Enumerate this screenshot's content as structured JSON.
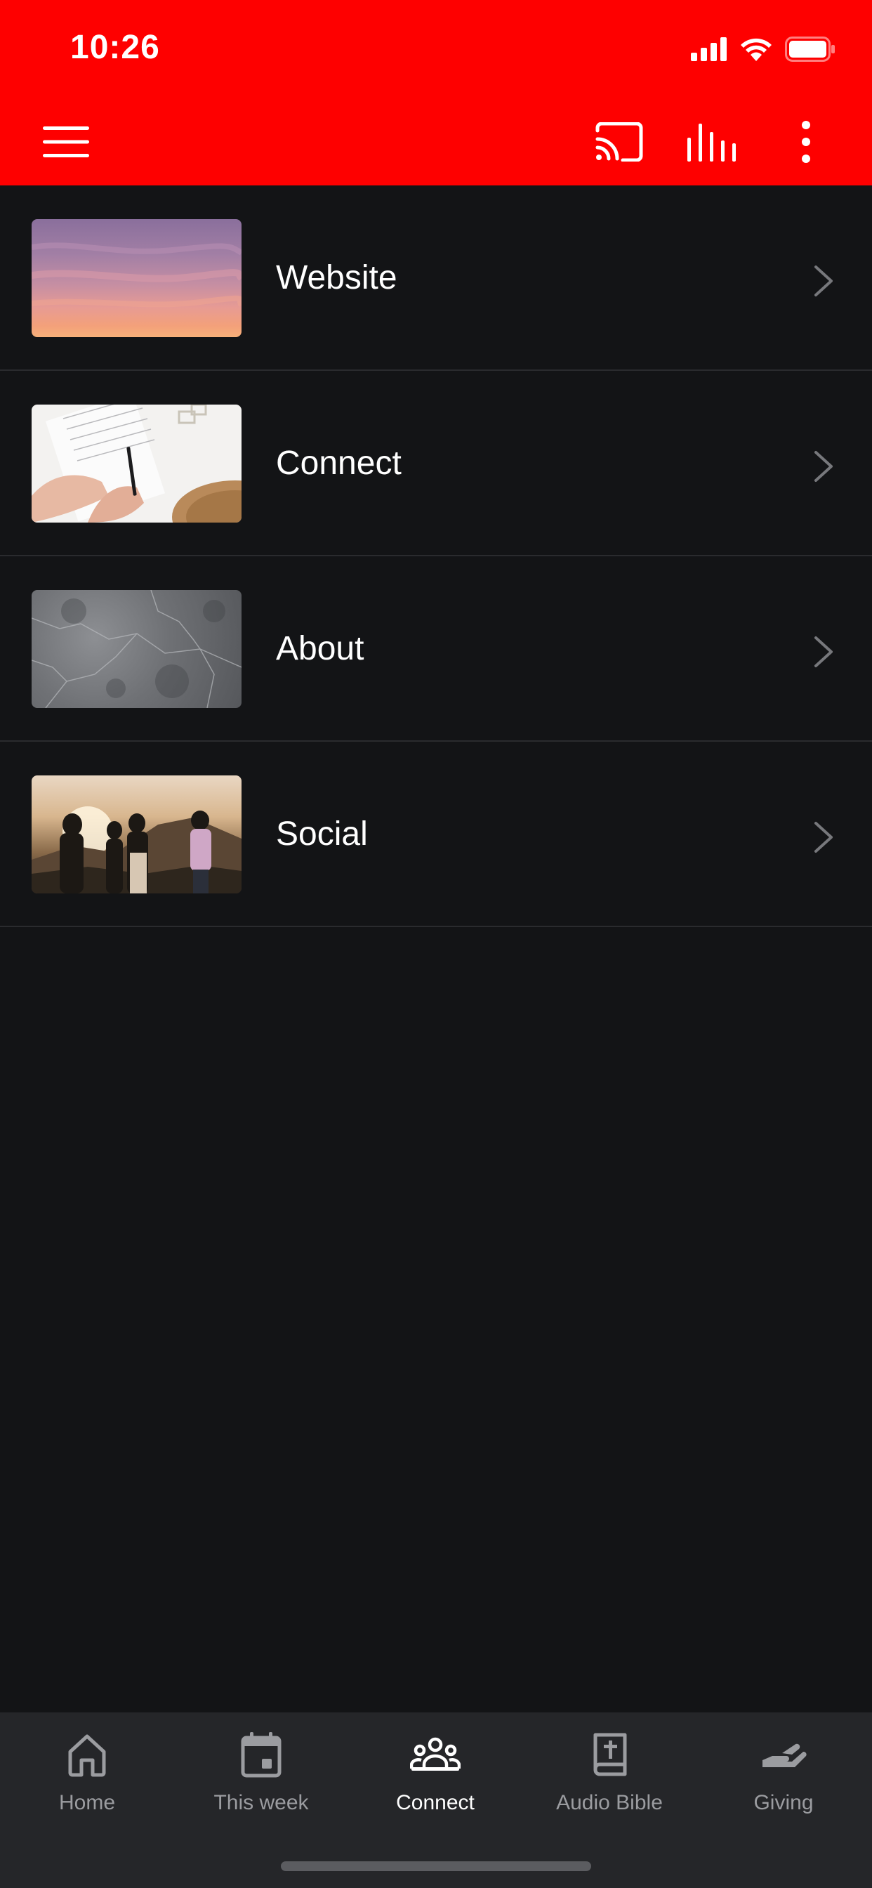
{
  "status_bar": {
    "time": "10:26",
    "icons": [
      "cellular-signal-icon",
      "wifi-icon",
      "battery-icon"
    ]
  },
  "toolbar": {
    "left_icon": "menu-icon",
    "right_icons": [
      "cast-icon",
      "audio-bars-icon",
      "more-vertical-icon"
    ],
    "background_color": "#fe0000"
  },
  "list": {
    "items": [
      {
        "label": "Website",
        "thumbnail": "sunset-sky-image"
      },
      {
        "label": "Connect",
        "thumbnail": "hands-writing-notebook-image"
      },
      {
        "label": "About",
        "thumbnail": "grey-marble-texture-image"
      },
      {
        "label": "Social",
        "thumbnail": "people-on-hill-at-sunset-image"
      }
    ]
  },
  "tabbar": {
    "active_tab": "Connect",
    "tabs": [
      {
        "label": "Home",
        "icon": "home-icon"
      },
      {
        "label": "This week",
        "icon": "calendar-icon"
      },
      {
        "label": "Connect",
        "icon": "people-group-icon"
      },
      {
        "label": "Audio Bible",
        "icon": "bible-icon"
      },
      {
        "label": "Giving",
        "icon": "giving-hand-icon"
      }
    ]
  },
  "colors": {
    "brand_red": "#fe0000",
    "background": "#131416",
    "tabbar_background": "#252629",
    "inactive_tab": "#9b9ca0",
    "active_tab": "#ffffff"
  }
}
